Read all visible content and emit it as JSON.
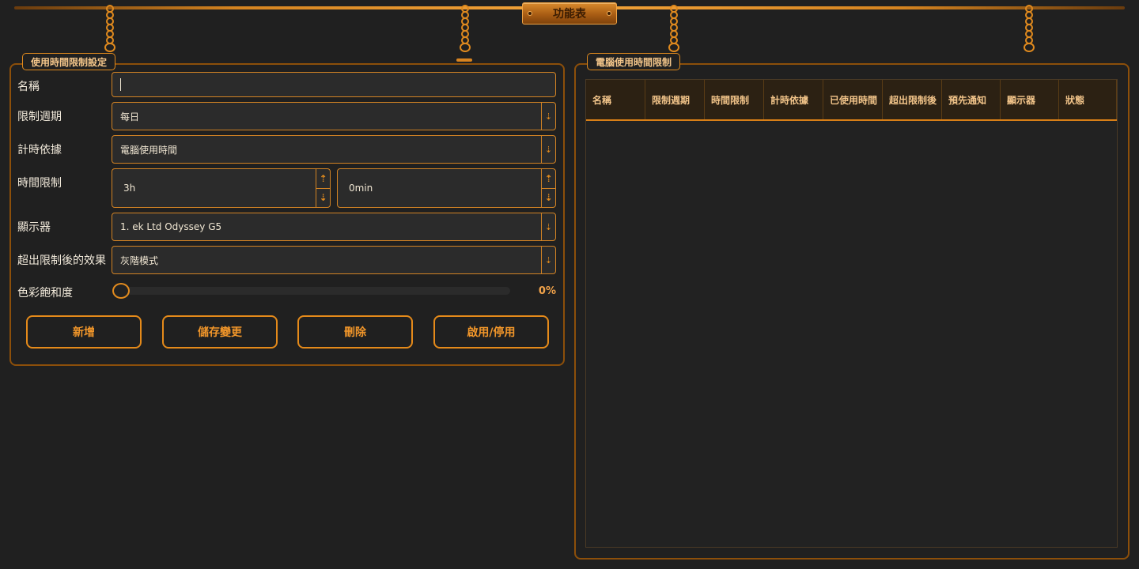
{
  "header": {
    "title": "功能表"
  },
  "settings_panel": {
    "legend": "使用時間限制設定",
    "fields": {
      "name": {
        "label": "名稱",
        "value": ""
      },
      "period": {
        "label": "限制週期",
        "value": "每日"
      },
      "basis": {
        "label": "計時依據",
        "value": "電腦使用時間"
      },
      "time_limit": {
        "label": "時間限制",
        "hours": "3h",
        "minutes": "0min"
      },
      "monitor": {
        "label": "顯示器",
        "value": "1. ek Ltd Odyssey G5"
      },
      "effect": {
        "label": "超出限制後的效果",
        "value": "灰階模式"
      },
      "saturation": {
        "label": "色彩飽和度",
        "value": "0%",
        "fraction": 0
      }
    },
    "buttons": {
      "add": "新增",
      "save": "儲存變更",
      "delete": "刪除",
      "toggle": "啟用/停用"
    }
  },
  "list_panel": {
    "legend": "電腦使用時間限制",
    "columns": [
      "名稱",
      "限制週期",
      "時間限制",
      "計時依據",
      "已使用時間",
      "超出限制後",
      "預先通知",
      "顯示器",
      "狀態"
    ],
    "rows": []
  },
  "colors": {
    "accent": "#e08a1e",
    "background": "#202020",
    "field": "#2b2b2b"
  },
  "icons": {
    "dropdown": "dropdown-arrow-icon",
    "spin_up": "spin-up-icon",
    "spin_down": "spin-down-icon"
  }
}
